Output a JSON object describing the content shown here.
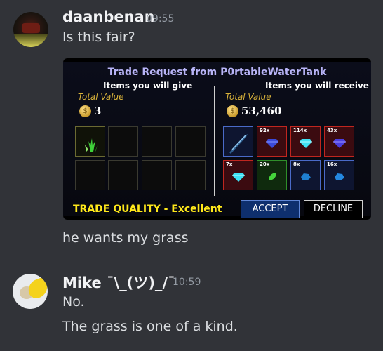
{
  "messages": [
    {
      "author": "daanbenan",
      "time": "09:55",
      "lines": [
        "Is this fair?",
        "he wants my grass"
      ]
    },
    {
      "author": "Mike ¯\\_(ツ)_/¯",
      "time": "10:59",
      "lines": [
        "No.",
        "The grass is one of a kind."
      ]
    }
  ],
  "trade": {
    "title": "Trade Request from P0rtableWaterTank",
    "give": {
      "heading": "Items you will give",
      "total_label": "Total Value",
      "total_value": "3",
      "items": [
        {
          "icon": "grass-icon",
          "count": ""
        }
      ]
    },
    "receive": {
      "heading": "Items you will receive",
      "total_label": "Total Value",
      "total_value": "53,460",
      "items": [
        {
          "icon": "sword-icon",
          "count": "",
          "color": "blue"
        },
        {
          "icon": "gem-icon",
          "count": "92x",
          "color": "red"
        },
        {
          "icon": "gem-icon",
          "count": "114x",
          "color": "red"
        },
        {
          "icon": "gem-icon",
          "count": "43x",
          "color": "red"
        },
        {
          "icon": "gem-icon",
          "count": "7x",
          "color": "red"
        },
        {
          "icon": "leaf-icon",
          "count": "20x",
          "color": "green"
        },
        {
          "icon": "ore-icon",
          "count": "8x",
          "color": "blue"
        },
        {
          "icon": "ore-icon",
          "count": "16x",
          "color": "blue"
        }
      ]
    },
    "quality": "TRADE QUALITY - Excellent",
    "accept_label": "ACCEPT",
    "decline_label": "DECLINE"
  },
  "colors": {
    "background": "#313338",
    "quality_text": "#ffe81a",
    "title_text": "#b8b4f7"
  }
}
